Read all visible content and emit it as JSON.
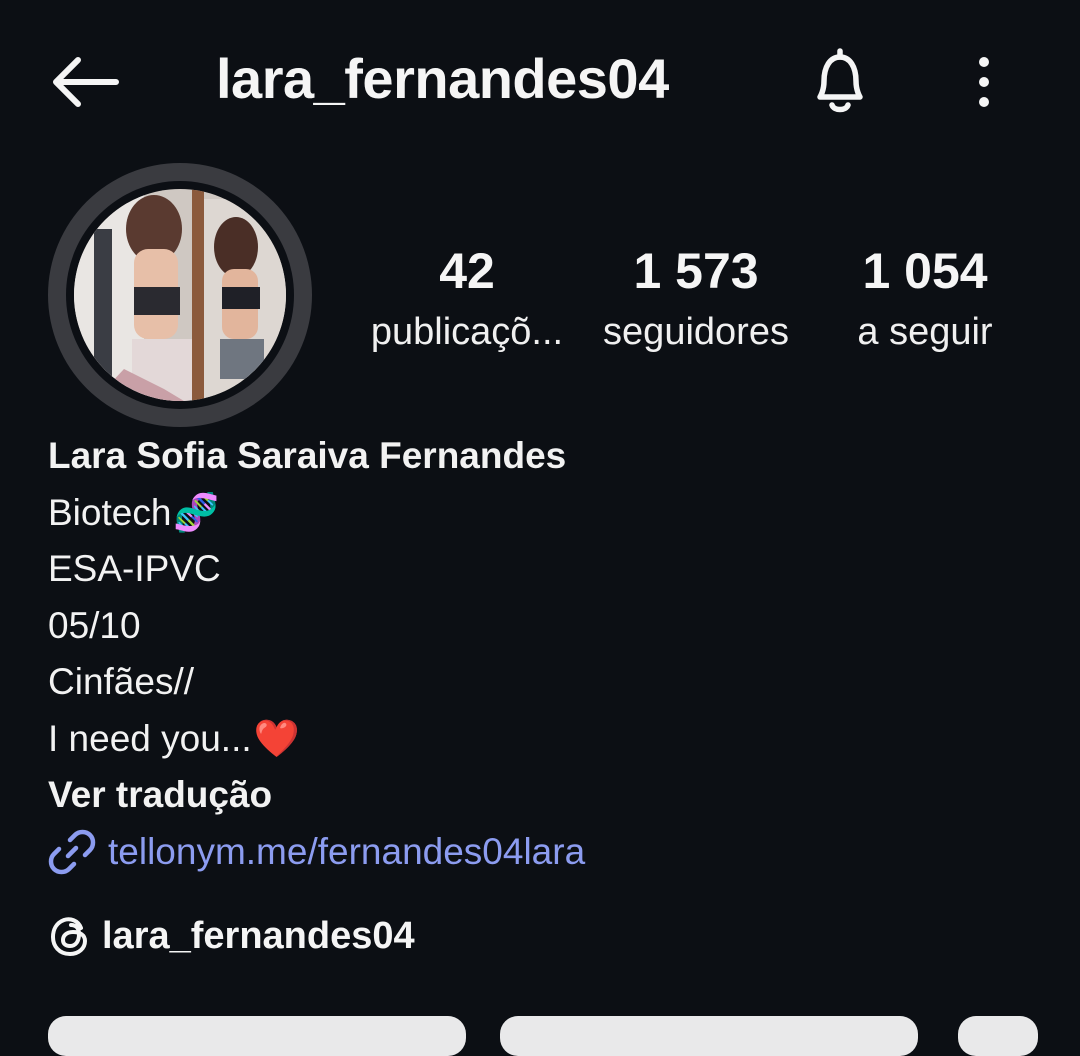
{
  "header": {
    "back_icon": "arrow-left-icon",
    "username": "lara_fernandes04",
    "bell_icon": "bell-icon",
    "more_icon": "more-vertical-icon"
  },
  "profile": {
    "avatar_icon": "profile-photo",
    "stats": [
      {
        "value": "42",
        "label": "publicaçõ..."
      },
      {
        "value": "1 573",
        "label": "seguidores"
      },
      {
        "value": "1 054",
        "label": "a seguir"
      }
    ]
  },
  "bio": {
    "full_name": "Lara Sofia Saraiva Fernandes",
    "lines": [
      "Biotech",
      "ESA-IPVC",
      "05/10",
      "Cinfães//",
      "I need you..."
    ],
    "dna_emoji": "🧬",
    "heart_emoji": "❤️",
    "translate_label": "Ver tradução",
    "link_icon": "link-icon",
    "link_text": "tellonym.me/fernandes04lara"
  },
  "threads": {
    "icon": "threads-icon",
    "handle": "lara_fernandes04"
  },
  "colors": {
    "background": "#0c0f14",
    "text": "#f5f5f5",
    "link": "#8c9cf0",
    "avatar_ring": "#3a3b40"
  }
}
